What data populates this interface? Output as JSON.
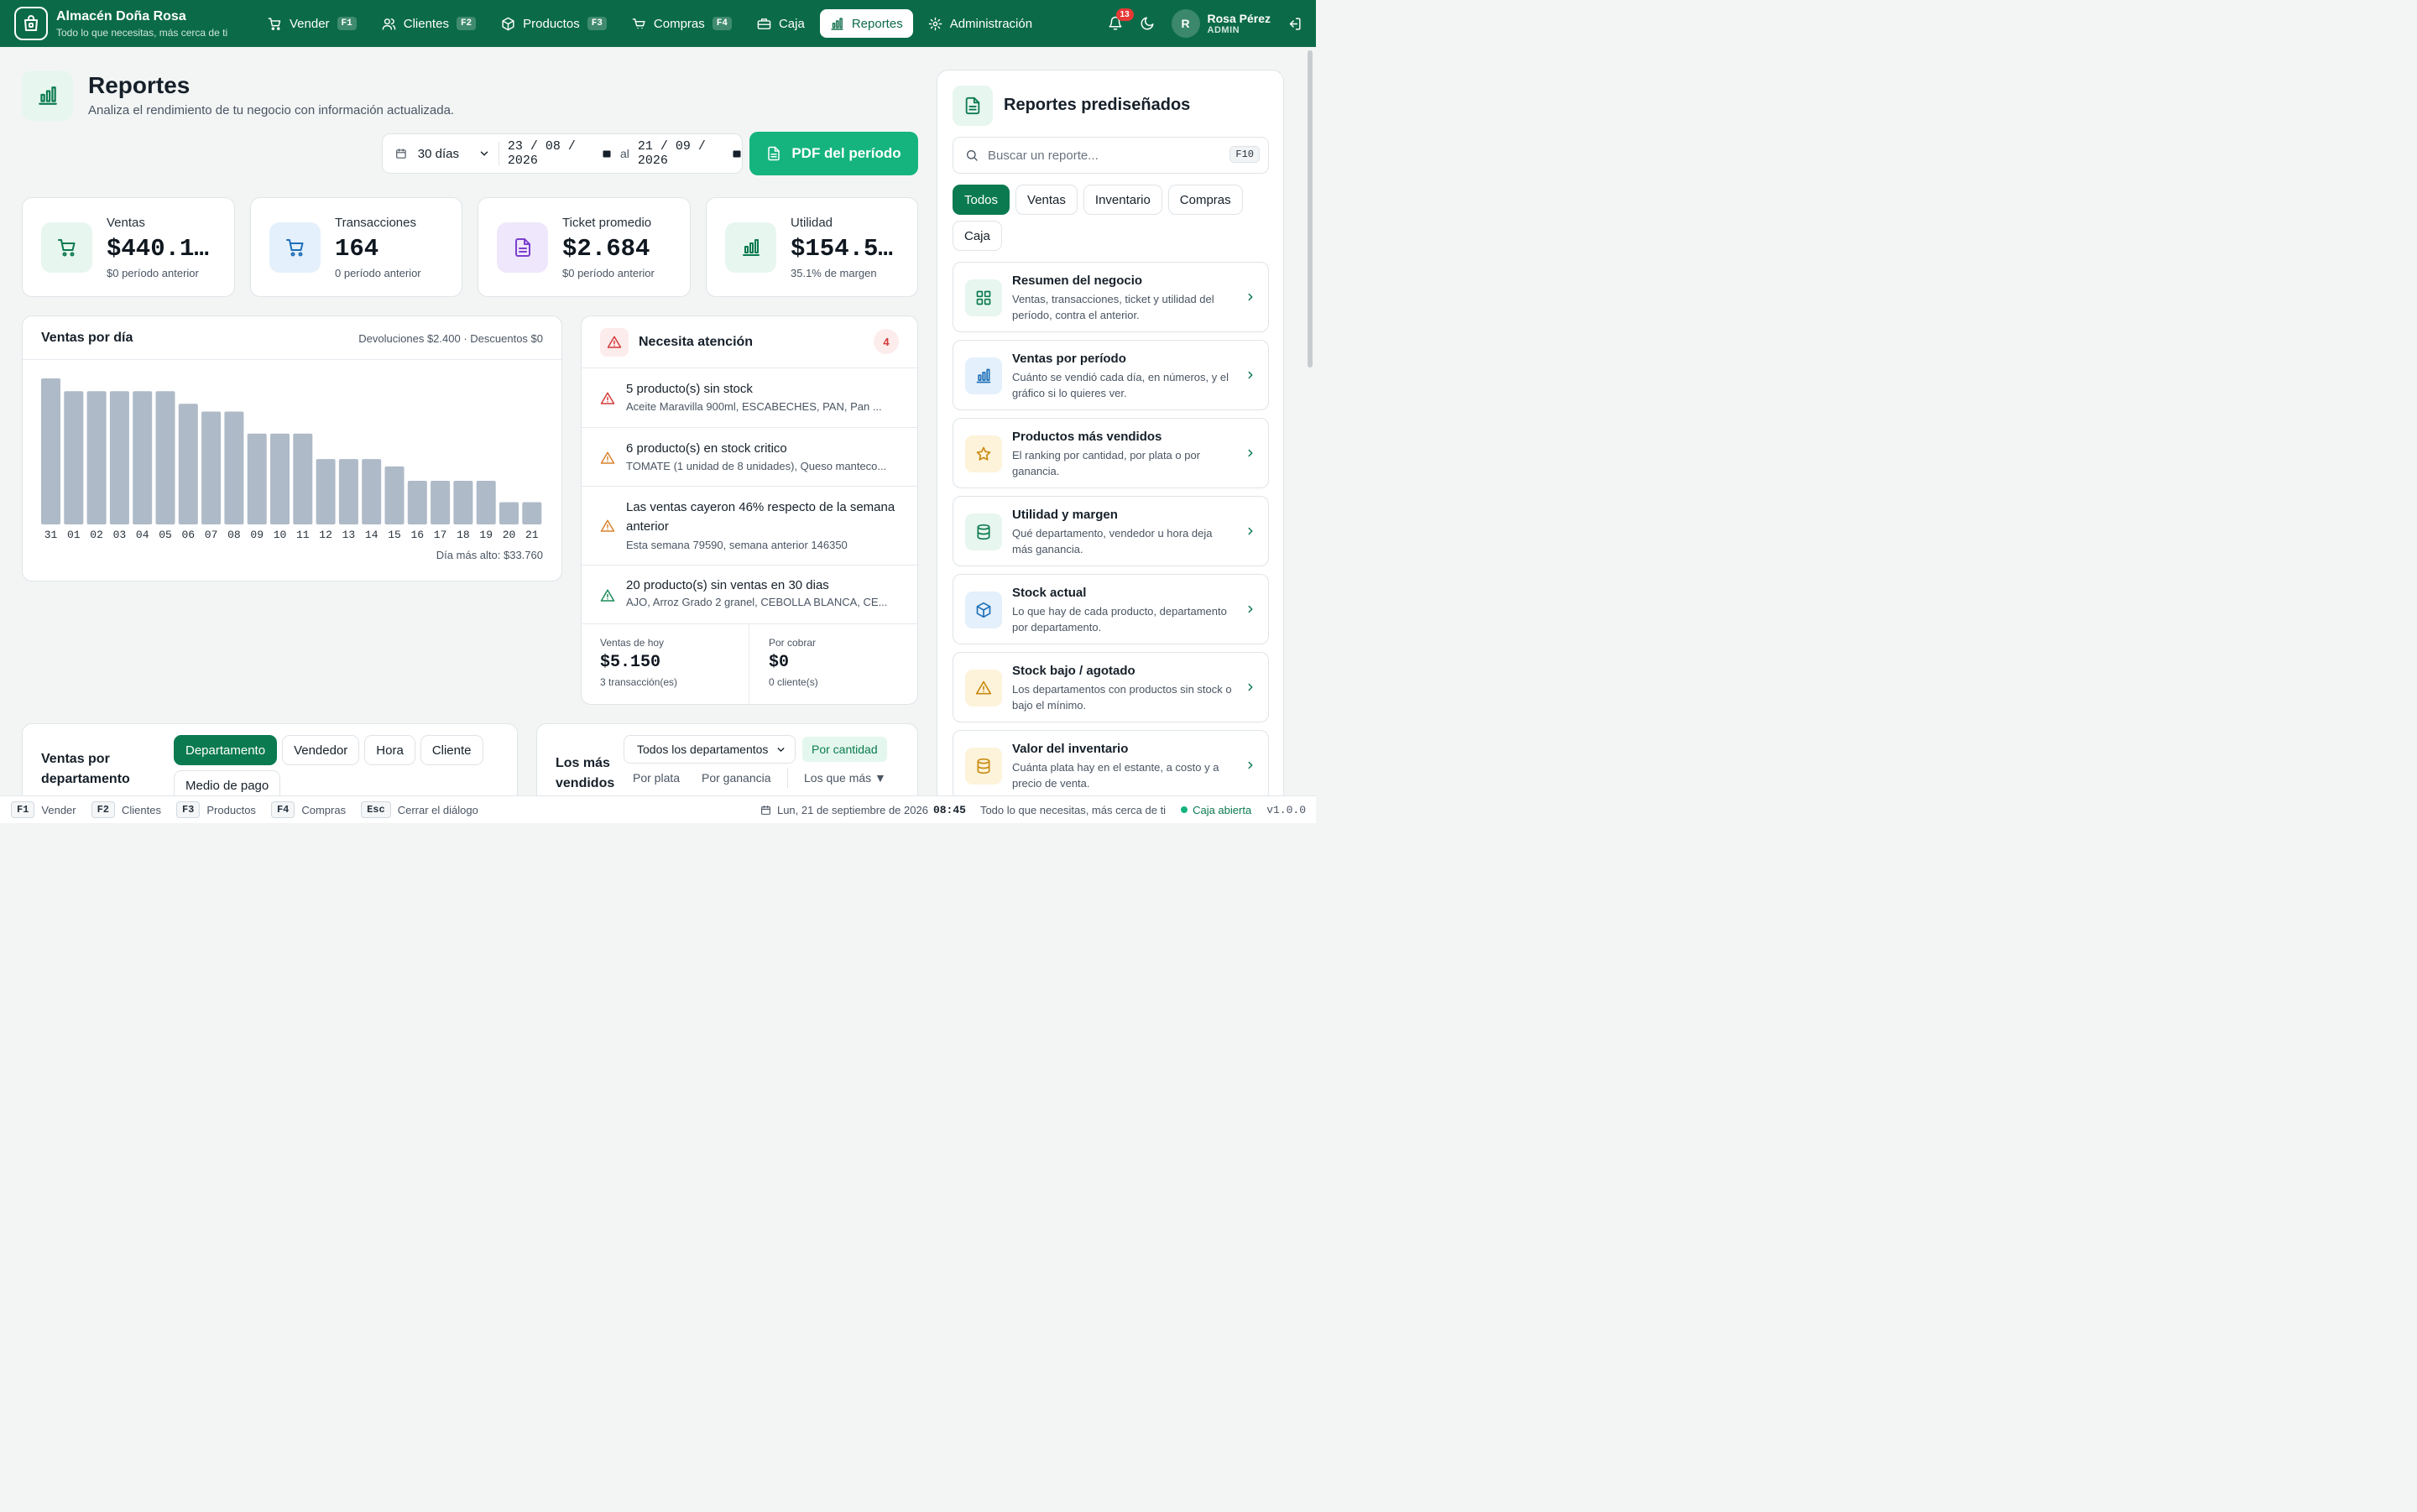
{
  "app": {
    "name": "Almacén Doña Rosa",
    "tagline": "Todo lo que necesitas, más cerca de ti"
  },
  "nav": [
    {
      "label": "Vender",
      "key": "F1",
      "icon": "cart-icon"
    },
    {
      "label": "Clientes",
      "key": "F2",
      "icon": "users-icon"
    },
    {
      "label": "Productos",
      "key": "F3",
      "icon": "box-icon"
    },
    {
      "label": "Compras",
      "key": "F4",
      "icon": "basket-icon"
    },
    {
      "label": "Caja",
      "key": "",
      "icon": "cash-register-icon"
    },
    {
      "label": "Reportes",
      "key": "",
      "icon": "bar-chart-icon",
      "active": true
    },
    {
      "label": "Administración",
      "key": "",
      "icon": "gear-icon"
    }
  ],
  "notifications": {
    "count": "13"
  },
  "user": {
    "initial": "R",
    "name": "Rosa Pérez",
    "role": "ADMIN"
  },
  "page": {
    "title": "Reportes",
    "subtitle": "Analiza el rendimiento de tu negocio con información actualizada."
  },
  "filter": {
    "range": "30 días",
    "from": "23 / 08 / 2026",
    "to_label": "al",
    "to": "21 / 09 / 2026",
    "pdf_button": "PDF del período"
  },
  "stats": [
    {
      "label": "Ventas",
      "value": "$440.1…",
      "note": "$0 período anterior",
      "icon": "cart-icon",
      "color": "#0b7a50",
      "bg": "#e7f6ef"
    },
    {
      "label": "Transacciones",
      "value": "164",
      "note": "0 período anterior",
      "icon": "cart-icon",
      "color": "#1d6fb8",
      "bg": "#e4f0fb"
    },
    {
      "label": "Ticket promedio",
      "value": "$2.684",
      "note": "$0 período anterior",
      "icon": "document-icon",
      "color": "#7b3fd0",
      "bg": "#efe7fb"
    },
    {
      "label": "Utilidad",
      "value": "$154.5…",
      "note": "35.1% de margen",
      "icon": "bar-chart-icon",
      "color": "#0b7a50",
      "bg": "#e7f6ef"
    }
  ],
  "sales_chart": {
    "title": "Ventas por día",
    "meta": "Devoluciones $2.400 · Descuentos $0",
    "footer": "Día más alto: $33.760"
  },
  "chart_data": {
    "type": "bar",
    "categories": [
      "31",
      "01",
      "02",
      "03",
      "04",
      "05",
      "06",
      "07",
      "08",
      "09",
      "10",
      "11",
      "12",
      "13",
      "14",
      "15",
      "16",
      "17",
      "18",
      "19",
      "20",
      "21"
    ],
    "values": [
      33760,
      30800,
      30800,
      30800,
      30800,
      30800,
      27900,
      26100,
      26100,
      21000,
      21000,
      21000,
      15100,
      15100,
      15100,
      13400,
      10100,
      10100,
      10100,
      10100,
      5150,
      5150
    ],
    "ylim": [
      0,
      33760
    ],
    "color": "#aebac7"
  },
  "attention": {
    "title": "Necesita atención",
    "count": "4",
    "items": [
      {
        "title": "5 producto(s) sin stock",
        "desc": "Aceite Maravilla 900ml, ESCABECHES, PAN, Pan ...",
        "icon": "alert-triangle-icon",
        "color": "#d33a3a"
      },
      {
        "title": "6 producto(s) en stock critico",
        "desc": "TOMATE (1 unidad de 8 unidades), Queso manteco...",
        "icon": "alert-triangle-icon",
        "color": "#d9822b"
      },
      {
        "title": "Las ventas cayeron 46% respecto de la semana anterior",
        "desc": "Esta semana 79590, semana anterior 146350",
        "icon": "alert-triangle-icon",
        "color": "#d9822b"
      },
      {
        "title": "20 producto(s) sin ventas en 30 dias",
        "desc": "AJO, Arroz Grado 2 granel, CEBOLLA BLANCA, CE...",
        "icon": "alert-triangle-icon",
        "color": "#1b8a5a"
      }
    ],
    "today": {
      "label": "Ventas de hoy",
      "value": "$5.150",
      "note": "3 transacción(es)"
    },
    "receivable": {
      "label": "Por cobrar",
      "value": "$0",
      "note": "0 cliente(s)"
    }
  },
  "by_department": {
    "title": "Ventas por departamento",
    "tabs": [
      "Departamento",
      "Vendedor",
      "Hora",
      "Cliente",
      "Medio de pago"
    ]
  },
  "top_sellers": {
    "title": "Los más vendidos",
    "department_select": "Todos los departamentos",
    "tabs": [
      "Por cantidad",
      "Por plata",
      "Por ganancia"
    ],
    "sort": "Los que más ▼"
  },
  "predesigned": {
    "title": "Reportes prediseñados",
    "search_placeholder": "Buscar un reporte...",
    "search_key": "F10",
    "filters": [
      "Todos",
      "Ventas",
      "Inventario",
      "Compras",
      "Caja"
    ],
    "items": [
      {
        "title": "Resumen del negocio",
        "desc": "Ventas, transacciones, ticket y utilidad del período, contra el anterior.",
        "icon": "grid-icon",
        "color": "#0b7a50",
        "bg": "#e7f6ef"
      },
      {
        "title": "Ventas por período",
        "desc": "Cuánto se vendió cada día, en números, y el gráfico si lo quieres ver.",
        "icon": "bar-chart-icon",
        "color": "#1d6fb8",
        "bg": "#e4f0fb"
      },
      {
        "title": "Productos más vendidos",
        "desc": "El ranking por cantidad, por plata o por ganancia.",
        "icon": "star-icon",
        "color": "#c98a10",
        "bg": "#fdf3da"
      },
      {
        "title": "Utilidad y margen",
        "desc": "Qué departamento, vendedor u hora deja más ganancia.",
        "icon": "database-icon",
        "color": "#0b7a50",
        "bg": "#e7f6ef"
      },
      {
        "title": "Stock actual",
        "desc": "Lo que hay de cada producto, departamento por departamento.",
        "icon": "cube-icon",
        "color": "#1d6fb8",
        "bg": "#e4f0fb"
      },
      {
        "title": "Stock bajo / agotado",
        "desc": "Los departamentos con productos sin stock o bajo el mínimo.",
        "icon": "alert-triangle-icon",
        "color": "#c98a10",
        "bg": "#fdf3da"
      },
      {
        "title": "Valor del inventario",
        "desc": "Cuánta plata hay en el estante, a costo y a precio de venta.",
        "icon": "database-icon",
        "color": "#c98a10",
        "bg": "#fdf3da"
      }
    ]
  },
  "statusbar": {
    "hints": [
      {
        "key": "F1",
        "label": "Vender"
      },
      {
        "key": "F2",
        "label": "Clientes"
      },
      {
        "key": "F3",
        "label": "Productos"
      },
      {
        "key": "F4",
        "label": "Compras"
      },
      {
        "key": "Esc",
        "label": "Cerrar el diálogo"
      }
    ],
    "date": "Lun, 21 de septiembre de 2026",
    "time": "08:45",
    "tagline": "Todo lo que necesitas, más cerca de ti",
    "cash_status": "Caja abierta",
    "version": "v1.0.0"
  }
}
